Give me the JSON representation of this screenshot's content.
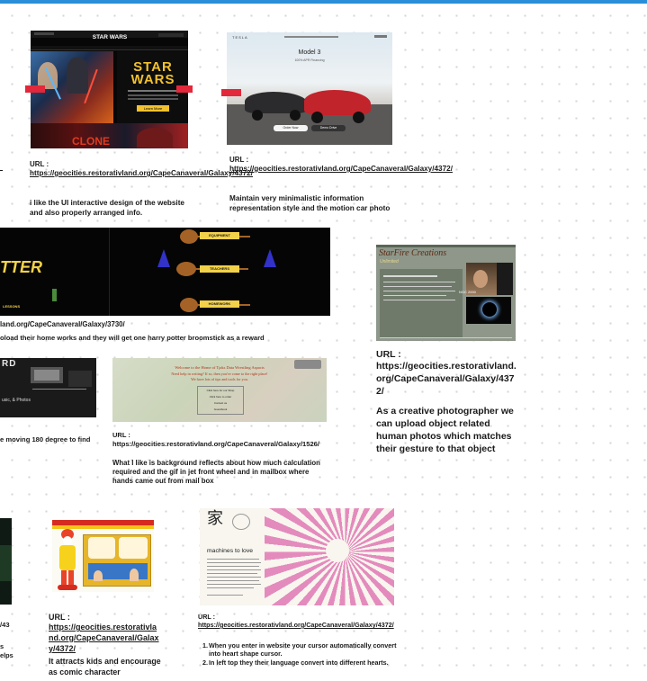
{
  "colors": {
    "accent": "#2a8fd8",
    "background": "#ffffff",
    "dot": "#d7d7d7",
    "text": "#1a1a1a"
  },
  "cards": {
    "starwars": {
      "thumb": {
        "logo": "STAR WARS",
        "poster": "STAR WARS",
        "title_red": "CLONE",
        "button": "Learn More"
      },
      "url_label": "URL :",
      "url": "https://geocities.restorativland.org/CapeCanaveral/Galaxy/4372/",
      "comment": "i like the UI interactive design of the website and also properly arranged info."
    },
    "tesla": {
      "thumb": {
        "brand": "TESLA",
        "title": "Model 3",
        "subtitle": "100% APR Financing",
        "btn_left": "Order Now",
        "btn_right": "Demo Drive"
      },
      "url_label": "URL :",
      "url": "https://geocities.restorativland.org/CapeCanaveral/Galaxy/4372/",
      "comment": "Maintain very minimalistic information representation style and the motion car photo"
    },
    "harrypotter": {
      "thumb": {
        "title": "TTER",
        "btn1": "EQUIPMENT",
        "btn2": "TEACHERS",
        "btn3": "HOMEWORK",
        "bottom": "LESSONS"
      },
      "url": "land.org/CapeCanaveral/Galaxy/3730/",
      "comment": "oload their home works and they will get one harry potter broomstick as a reward"
    },
    "starfire": {
      "thumb": {
        "title": "StarFire Creations",
        "subtitle": "Unlimited",
        "caption": "NGC 2000"
      },
      "url_label": "URL :",
      "url": "https://geocities.restorativland.org/CapeCanaveral/Galaxy/4372/",
      "comment": "As a creative photographer we can upload object related human photos which matches their gesture to that object"
    },
    "darkrd": {
      "thumb": {
        "title": "RD",
        "footer": "usic, & Photos"
      },
      "comment": "e moving 180 degree to find"
    },
    "mailbox": {
      "thumb": {
        "heading": "Welcome to the Home of Tjaks Data Wrestling Aspacts",
        "line1": "Need help in writing? If so, then you've come to the right place!",
        "line2": "We have lots of tips and tools for you.",
        "links": [
          "Click here for our Shop",
          "Click here to order",
          "Contact us",
          "Guestbook"
        ]
      },
      "url_label": "URL :",
      "url": "https://geocities.restorativland.org/CapeCanaveral/Galaxy/1526/",
      "comment": "What I like is background reflects about how much calculation required and the gif in jet front wheel and in mailbox where hands came out from mail box"
    },
    "leftedge": {
      "url": "/43",
      "line1": "s",
      "line2": "elps"
    },
    "mcdonald": {
      "url_label": "URL :",
      "url": "https://geocities.restorativland.org/CapeCanaveral/Galaxy/4372/",
      "comment": "It attracts kids and encourage as comic character"
    },
    "machines": {
      "thumb": {
        "kanji": "家",
        "title": "machines to love"
      },
      "url_label": "URL :",
      "url": "https://geocities.restorativland.org/CapeCanaveral/Galaxy/4372/",
      "points": [
        "When you enter in website your cursor automatically convert into heart shape cursor.",
        "In left top they their language convert into different hearts."
      ]
    }
  }
}
